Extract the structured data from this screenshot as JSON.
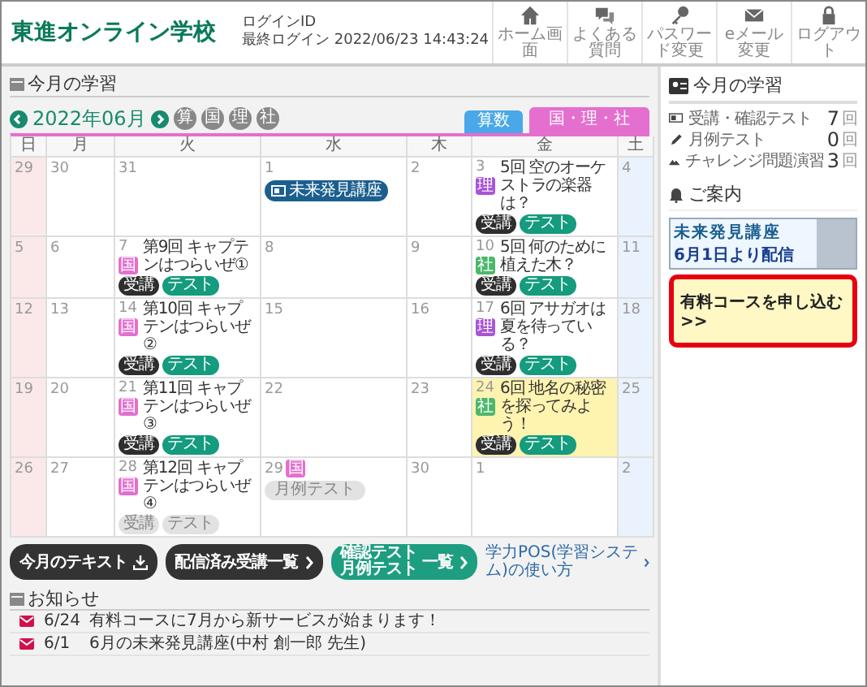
{
  "header": {
    "logo": "東進オンライン学校",
    "login_id_label": "ログインID",
    "last_login": "最終ログイン 2022/06/23 14:43:24",
    "nav": [
      {
        "label": "ホーム画面"
      },
      {
        "label": "よくある質問"
      },
      {
        "label": "パスワード変更"
      },
      {
        "label": "eメール変更"
      },
      {
        "label": "ログアウト"
      }
    ]
  },
  "study": {
    "title": "今月の学習",
    "month": "2022年06月",
    "subject_badges": [
      "算",
      "国",
      "理",
      "社"
    ],
    "tabs": [
      {
        "label": "算数",
        "selected": false,
        "color": "#4aa8e8"
      },
      {
        "label": "国・理・社",
        "selected": true,
        "color": "#e46fcf"
      }
    ],
    "weekdays": [
      "日",
      "月",
      "火",
      "水",
      "木",
      "金",
      "土"
    ],
    "weeks": [
      [
        {
          "day": "29",
          "today": false
        },
        {
          "day": "30",
          "today": false
        },
        {
          "day": "31",
          "today": false
        },
        {
          "day": "1",
          "today": false,
          "events": [
            {
              "kind": "special",
              "label": "未来発見講座"
            }
          ]
        },
        {
          "day": "2",
          "today": false
        },
        {
          "day": "3",
          "today": false,
          "events": [
            {
              "kind": "lesson",
              "tag": "理",
              "color": "#a855d4",
              "title": "5回 空のオーケストラの楽器は？",
              "buttons": [
                "受講",
                "テスト"
              ],
              "disabled": false
            }
          ]
        },
        {
          "day": "4",
          "today": false
        }
      ],
      [
        {
          "day": "5",
          "today": false
        },
        {
          "day": "6",
          "today": false
        },
        {
          "day": "7",
          "today": false,
          "events": [
            {
              "kind": "lesson",
              "tag": "国",
              "color": "#e46fcf",
              "title": "第9回 キャプテンはつらいぜ①",
              "buttons": [
                "受講",
                "テスト"
              ],
              "disabled": false
            }
          ]
        },
        {
          "day": "8",
          "today": false
        },
        {
          "day": "9",
          "today": false
        },
        {
          "day": "10",
          "today": false,
          "events": [
            {
              "kind": "lesson",
              "tag": "社",
              "color": "#4bb86a",
              "title": "5回 何のために植えた木？",
              "buttons": [
                "受講",
                "テスト"
              ],
              "disabled": false
            }
          ]
        },
        {
          "day": "11",
          "today": false
        }
      ],
      [
        {
          "day": "12",
          "today": false
        },
        {
          "day": "13",
          "today": false
        },
        {
          "day": "14",
          "today": false,
          "events": [
            {
              "kind": "lesson",
              "tag": "国",
              "color": "#e46fcf",
              "title": "第10回 キャプテンはつらいぜ②",
              "buttons": [
                "受講",
                "テスト"
              ],
              "disabled": false
            }
          ]
        },
        {
          "day": "15",
          "today": false
        },
        {
          "day": "16",
          "today": false
        },
        {
          "day": "17",
          "today": false,
          "events": [
            {
              "kind": "lesson",
              "tag": "理",
              "color": "#a855d4",
              "title": "6回 アサガオは夏を待っている？",
              "buttons": [
                "受講",
                "テスト"
              ],
              "disabled": false
            }
          ]
        },
        {
          "day": "18",
          "today": false
        }
      ],
      [
        {
          "day": "19",
          "today": false
        },
        {
          "day": "20",
          "today": false
        },
        {
          "day": "21",
          "today": false,
          "events": [
            {
              "kind": "lesson",
              "tag": "国",
              "color": "#e46fcf",
              "title": "第11回 キャプテンはつらいぜ③",
              "buttons": [
                "受講",
                "テスト"
              ],
              "disabled": false
            }
          ]
        },
        {
          "day": "22",
          "today": false
        },
        {
          "day": "23",
          "today": false
        },
        {
          "day": "24",
          "today": true,
          "events": [
            {
              "kind": "lesson",
              "tag": "社",
              "color": "#4bb86a",
              "title": "6回 地名の秘密を探ってみよう！",
              "buttons": [
                "受講",
                "テスト"
              ],
              "disabled": false
            }
          ]
        },
        {
          "day": "25",
          "today": false
        }
      ],
      [
        {
          "day": "26",
          "today": false
        },
        {
          "day": "27",
          "today": false
        },
        {
          "day": "28",
          "today": false,
          "events": [
            {
              "kind": "lesson",
              "tag": "国",
              "color": "#e46fcf",
              "title": "第12回 キャプテンはつらいぜ④",
              "buttons": [
                "受講",
                "テスト"
              ],
              "disabled": true
            }
          ]
        },
        {
          "day": "29",
          "today": false,
          "events": [
            {
              "kind": "monthly_test",
              "tag": "国",
              "color": "#e46fcf",
              "label": "月例テスト",
              "disabled": true
            }
          ]
        },
        {
          "day": "30",
          "today": false
        },
        {
          "day": "1",
          "today": false
        },
        {
          "day": "2",
          "today": false
        }
      ]
    ]
  },
  "actions": {
    "buttons": [
      {
        "kind": "download",
        "label": "今月のテキスト"
      },
      {
        "kind": "list",
        "label": "配信済み受講一覧"
      },
      {
        "kind": "tests",
        "lines": [
          "確認テスト",
          "月例テスト"
        ],
        "label": "一覧"
      }
    ],
    "help_link": "学力POS(学習システム)の使い方"
  },
  "news": {
    "title": "お知らせ",
    "items": [
      {
        "date": "6/24",
        "text": "有料コースに7月から新サービスが始まります！"
      },
      {
        "date": "6/1",
        "text": "6月の未来発見講座(中村 創一郎 先生)"
      }
    ]
  },
  "sidebar": {
    "title": "今月の学習",
    "stats": [
      {
        "label": "受講・確認テスト",
        "count": "7",
        "unit": "回"
      },
      {
        "label": "月例テスト",
        "count": "0",
        "unit": "回"
      },
      {
        "label": "チャレンジ問題演習",
        "count": "3",
        "unit": "回"
      }
    ],
    "notice_title": "ご案内",
    "banner": {
      "title": "未来発見講座",
      "date": "6月1日より配信"
    },
    "cta": "有料コースを申し込む >>"
  }
}
